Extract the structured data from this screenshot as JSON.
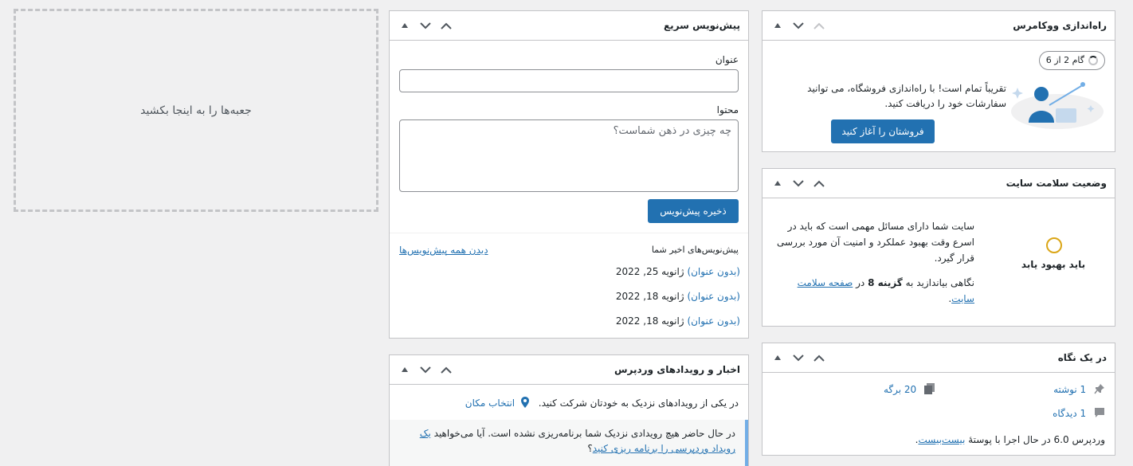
{
  "dropzone": {
    "text": "جعبه‌ها را به اینجا بکشید"
  },
  "quick_draft": {
    "title": "پیش‌نویس سریع",
    "title_label": "عنوان",
    "title_value": "",
    "content_label": "محتوا",
    "content_placeholder": "چه چیزی در ذهن شماست؟",
    "save_label": "ذخیره پیش‌نویس",
    "recent_label": "پیش‌نویس‌های اخیر شما",
    "view_all_label": "دیدن همه پیش‌نویس‌ها",
    "drafts": [
      {
        "title": "(بدون عنوان)",
        "date": "ژانویه 25, 2022"
      },
      {
        "title": "(بدون عنوان)",
        "date": "ژانویه 18, 2022"
      },
      {
        "title": "(بدون عنوان)",
        "date": "ژانویه 18, 2022"
      }
    ]
  },
  "news": {
    "title": "اخبار و رویدادهای وردپرس",
    "intro": "در یکی از رویدادهای نزدیک به خودتان شرکت کنید.",
    "location_label": "انتخاب مکان",
    "notice_text": "در حال حاضر هیچ رویدادی نزدیک شما برنامه‌ریزی نشده است. آیا می‌خواهید",
    "notice_link": "یک رویداد وردپرسی را برنامه ریزی کنید",
    "notice_end": "؟"
  },
  "woo_setup": {
    "title": "راه‌اندازی ووکامرس",
    "step_badge": "گام 2 از 6",
    "text": "تقریباً تمام است! با راه‌اندازی فروشگاه، می توانید سفارشات خود را دریافت کنید.",
    "button_label": "فروشتان را آغاز کنید"
  },
  "site_health": {
    "title": "وضعیت سلامت سایت",
    "status_label": "باید بهبود یابد",
    "text1": "سایت شما دارای مسائل مهمی است که باید در اسرع وقت بهبود عملکرد و امنیت آن مورد بررسی قرار گیرد.",
    "text2_before": "نگاهی بیاندازید به",
    "text2_bold": "گزینه 8",
    "text2_mid": "در",
    "text2_link": "صفحه سلامت سایت",
    "text2_end": "."
  },
  "glance": {
    "title": "در یک نگاه",
    "posts": "1 نوشته",
    "pages": "20 برگه",
    "comments": "1 دیدگاه",
    "wp_text": "وردپرس 6.0 در حال اجرا با پوستهٔ",
    "theme_link": "بیست‌بیست",
    "wp_end": "."
  },
  "colors": {
    "accent": "#2271b1",
    "health_ring": "#dba617"
  }
}
